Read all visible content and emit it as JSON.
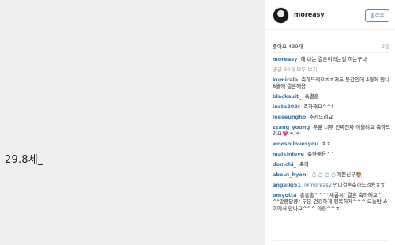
{
  "post": {
    "image_text": "29.8세_"
  },
  "header": {
    "username": "moreasy",
    "follow_label": "팔로우"
  },
  "meta": {
    "likes": "좋아요 439개",
    "time_ago": "2일"
  },
  "caption": {
    "author": "moreasy",
    "text": "에 나는 결혼이라는걸 하는구나"
  },
  "load_more": "댓글 30개 모두 보기",
  "comments": [
    {
      "author": "kumirala",
      "text": "축하드려요ㅎㅎ저두 동갑인데 4월에 만나 8월에 결혼해용"
    },
    {
      "author": "blacksuit_",
      "text": "축결홈"
    },
    {
      "author": "insta202r",
      "text": "축하해요^^!"
    },
    {
      "author": "leeseungho",
      "text": "추카드려요"
    },
    {
      "author": "zzang_young",
      "text": "두분 너무 진짜진짜 어울려요 축하드려요💗💌💌"
    },
    {
      "author": "woosollovesyou",
      "text": "ㅊㅊ"
    },
    {
      "author": "maikinlove",
      "text": "축하해용^^"
    },
    {
      "author": "domchi_",
      "text": "축하"
    },
    {
      "author": "about_hyoni",
      "text": "💍💍💍💍예쁜신부👰"
    },
    {
      "author": "angelkj51",
      "mention": "@moreasy",
      "text": "언니결혼축하드려용ㅎㅎ"
    },
    {
      "author": "omyotta",
      "text": "홍홍홍^^^\"새롬씨\" 결혼 축하해요^^\"알콩달콩\" 두분 건강하게 행복하게^^^ 오늘밤 쇼미에서 만나요^^^ 아응^^ㅎ"
    }
  ]
}
